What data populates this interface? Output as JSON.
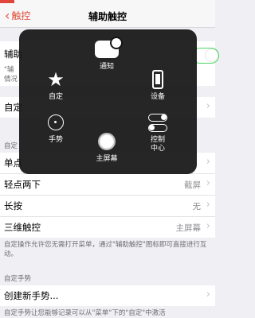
{
  "nav": {
    "back_label": "触控",
    "title": "辅助触控"
  },
  "rows": {
    "assistive_touch": {
      "label": "辅助"
    },
    "customize": {
      "label": "自定"
    },
    "single_tap": {
      "label": "单点"
    },
    "double_tap": {
      "label": "轻点两下",
      "value": "截屏"
    },
    "long_press": {
      "label": "长按",
      "value": "无"
    },
    "three_d_touch": {
      "label": "三维触控",
      "value": "主屏幕"
    },
    "create_gesture": {
      "label": "创建新手势..."
    }
  },
  "notes": {
    "at_desc_line1": "\"辅",
    "at_desc_line2": "情况",
    "custom_actions_header": "自定",
    "custom_actions_footer": "自定操作允许您无需打开菜单，通过\"辅助触控\"图标即可直接进行互动。",
    "custom_gestures_header": "自定手势",
    "custom_gestures_footer": "自定手势让您能够记录可以从\"菜单\"下的\"自定\"中激活"
  },
  "menu": {
    "notification": "通知",
    "custom": "自定",
    "device": "设备",
    "gestures": "手势",
    "home_screen": "主屏幕",
    "control_center": "控制\n中心"
  },
  "toggle": {
    "on": true,
    "color": "#4cd964"
  }
}
